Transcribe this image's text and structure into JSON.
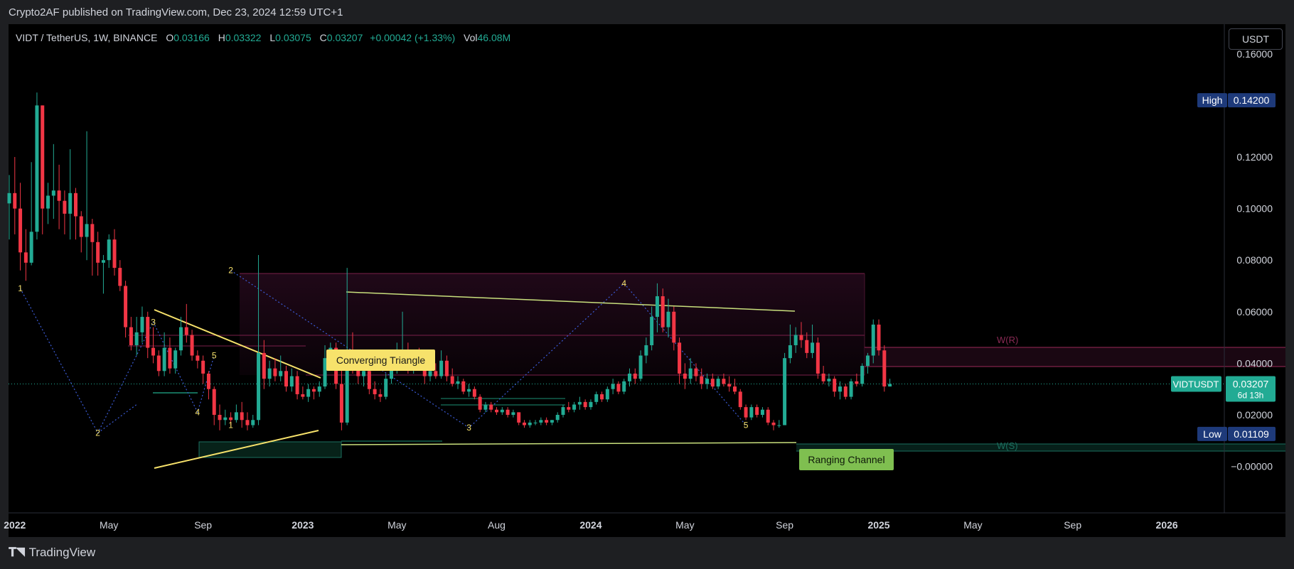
{
  "publisher_line": "Crypto2AF published on TradingView.com, Dec 23, 2024 12:59 UTC+1",
  "legend": {
    "symbol": "VIDT / TetherUS, 1W, BINANCE",
    "open_label": "O",
    "open": "0.03166",
    "high_label": "H",
    "high": "0.03322",
    "low_label": "L",
    "low": "0.03075",
    "close_label": "C",
    "close": "0.03207",
    "change": "+0.00042 (+1.33%)",
    "vol_label": "Vol",
    "vol": "46.08M"
  },
  "currency_button": "USDT",
  "brand": "TradingView",
  "colors": {
    "up": "#22ab94",
    "down": "#f23645",
    "accent_yellow": "#f7e26b",
    "background": "#000000"
  },
  "chart_data": {
    "type": "candlestick",
    "ylim": [
      -0.012,
      0.177
    ],
    "y_ticks": [
      {
        "value": 0.16,
        "label": "0.16000"
      },
      {
        "value": 0.12,
        "label": "0.12000"
      },
      {
        "value": 0.1,
        "label": "0.10000"
      },
      {
        "value": 0.08,
        "label": "0.08000"
      },
      {
        "value": 0.06,
        "label": "0.06000"
      },
      {
        "value": 0.04,
        "label": "0.04000"
      },
      {
        "value": 0.02,
        "label": "0.02000"
      },
      {
        "value": 0.0,
        "label": "−0.00000"
      }
    ],
    "x_ticks": [
      {
        "i": -16,
        "label": "Sep"
      },
      {
        "i": 1,
        "label": "2022",
        "bold": true
      },
      {
        "i": 18,
        "label": "May"
      },
      {
        "i": 35,
        "label": "Sep"
      },
      {
        "i": 53,
        "label": "2023",
        "bold": true
      },
      {
        "i": 70,
        "label": "May"
      },
      {
        "i": 88,
        "label": "Aug"
      },
      {
        "i": 105,
        "label": "2024",
        "bold": true
      },
      {
        "i": 122,
        "label": "May"
      },
      {
        "i": 140,
        "label": "Sep"
      },
      {
        "i": 157,
        "label": "2025",
        "bold": true
      },
      {
        "i": 174,
        "label": "May"
      },
      {
        "i": 192,
        "label": "Sep"
      },
      {
        "i": 209,
        "label": "2026",
        "bold": true
      }
    ],
    "price_markers": [
      {
        "label": "High",
        "value": "0.14200",
        "y": 0.142
      },
      {
        "label": "Low",
        "value": "0.01109",
        "y": 0.0126
      },
      {
        "label": "VIDTUSDT",
        "value": "0.03207",
        "sub": "6d 13h",
        "y": 0.032
      }
    ],
    "annotations": {
      "converging_triangle": "Converging Triangle",
      "ranging_channel": "Ranging Channel",
      "wr": "W(R)",
      "ws": "W(S)"
    },
    "wave_labels": [
      {
        "text": "1",
        "i": 2,
        "y": 0.069
      },
      {
        "text": "2",
        "i": 16,
        "y": 0.013
      },
      {
        "text": "3",
        "i": 26,
        "y": 0.056
      },
      {
        "text": "4",
        "i": 34,
        "y": 0.021
      },
      {
        "text": "5",
        "i": 37,
        "y": 0.043
      },
      {
        "text": "1",
        "i": 40,
        "y": 0.016
      },
      {
        "text": "2",
        "i": 40,
        "y": 0.076
      },
      {
        "text": "3",
        "i": 83,
        "y": 0.015
      },
      {
        "text": "4",
        "i": 111,
        "y": 0.071
      },
      {
        "text": "5",
        "i": 133,
        "y": 0.016
      }
    ],
    "ohlc": [
      [
        0.102,
        0.113,
        0.088,
        0.106
      ],
      [
        0.106,
        0.12,
        0.09,
        0.1
      ],
      [
        0.1,
        0.11,
        0.076,
        0.083
      ],
      [
        0.083,
        0.092,
        0.072,
        0.079
      ],
      [
        0.079,
        0.118,
        0.078,
        0.091
      ],
      [
        0.091,
        0.145,
        0.088,
        0.14
      ],
      [
        0.14,
        0.14,
        0.09,
        0.1
      ],
      [
        0.1,
        0.11,
        0.094,
        0.105
      ],
      [
        0.105,
        0.125,
        0.096,
        0.107
      ],
      [
        0.107,
        0.117,
        0.092,
        0.103
      ],
      [
        0.103,
        0.107,
        0.09,
        0.098
      ],
      [
        0.098,
        0.123,
        0.088,
        0.106
      ],
      [
        0.106,
        0.108,
        0.088,
        0.097
      ],
      [
        0.097,
        0.099,
        0.083,
        0.089
      ],
      [
        0.089,
        0.13,
        0.08,
        0.094
      ],
      [
        0.094,
        0.096,
        0.074,
        0.087
      ],
      [
        0.087,
        0.091,
        0.074,
        0.079
      ],
      [
        0.079,
        0.082,
        0.067,
        0.08
      ],
      [
        0.08,
        0.09,
        0.077,
        0.088
      ],
      [
        0.088,
        0.092,
        0.074,
        0.077
      ],
      [
        0.077,
        0.08,
        0.068,
        0.07
      ],
      [
        0.07,
        0.072,
        0.05,
        0.054
      ],
      [
        0.054,
        0.058,
        0.045,
        0.047
      ],
      [
        0.047,
        0.058,
        0.043,
        0.052
      ],
      [
        0.052,
        0.062,
        0.048,
        0.058
      ],
      [
        0.058,
        0.06,
        0.042,
        0.046
      ],
      [
        0.046,
        0.054,
        0.04,
        0.043
      ],
      [
        0.043,
        0.045,
        0.035,
        0.037
      ],
      [
        0.037,
        0.052,
        0.035,
        0.046
      ],
      [
        0.046,
        0.05,
        0.036,
        0.038
      ],
      [
        0.038,
        0.046,
        0.036,
        0.045
      ],
      [
        0.045,
        0.058,
        0.043,
        0.054
      ],
      [
        0.054,
        0.063,
        0.048,
        0.051
      ],
      [
        0.051,
        0.053,
        0.041,
        0.043
      ],
      [
        0.043,
        0.045,
        0.038,
        0.041
      ],
      [
        0.041,
        0.043,
        0.032,
        0.036
      ],
      [
        0.036,
        0.037,
        0.026,
        0.03
      ],
      [
        0.03,
        0.031,
        0.016,
        0.02
      ],
      [
        0.02,
        0.024,
        0.014,
        0.018
      ],
      [
        0.018,
        0.022,
        0.016,
        0.019
      ],
      [
        0.019,
        0.021,
        0.016,
        0.018
      ],
      [
        0.018,
        0.024,
        0.017,
        0.021
      ],
      [
        0.021,
        0.025,
        0.015,
        0.018
      ],
      [
        0.018,
        0.021,
        0.014,
        0.016
      ],
      [
        0.016,
        0.02,
        0.015,
        0.018
      ],
      [
        0.018,
        0.082,
        0.016,
        0.044
      ],
      [
        0.044,
        0.049,
        0.03,
        0.034
      ],
      [
        0.034,
        0.041,
        0.031,
        0.038
      ],
      [
        0.038,
        0.042,
        0.033,
        0.035
      ],
      [
        0.035,
        0.043,
        0.033,
        0.037
      ],
      [
        0.037,
        0.039,
        0.029,
        0.031
      ],
      [
        0.031,
        0.038,
        0.029,
        0.035
      ],
      [
        0.035,
        0.037,
        0.026,
        0.028
      ],
      [
        0.028,
        0.031,
        0.026,
        0.027
      ],
      [
        0.027,
        0.032,
        0.025,
        0.03
      ],
      [
        0.03,
        0.031,
        0.026,
        0.029
      ],
      [
        0.029,
        0.033,
        0.027,
        0.031
      ],
      [
        0.031,
        0.047,
        0.03,
        0.042
      ],
      [
        0.042,
        0.048,
        0.038,
        0.046
      ],
      [
        0.046,
        0.048,
        0.03,
        0.032
      ],
      [
        0.032,
        0.042,
        0.014,
        0.017
      ],
      [
        0.017,
        0.077,
        0.016,
        0.044
      ],
      [
        0.044,
        0.052,
        0.036,
        0.038
      ],
      [
        0.038,
        0.042,
        0.032,
        0.035
      ],
      [
        0.035,
        0.04,
        0.031,
        0.037
      ],
      [
        0.037,
        0.04,
        0.028,
        0.03
      ],
      [
        0.03,
        0.033,
        0.026,
        0.028
      ],
      [
        0.028,
        0.03,
        0.025,
        0.027
      ],
      [
        0.027,
        0.036,
        0.026,
        0.034
      ],
      [
        0.034,
        0.04,
        0.032,
        0.038
      ],
      [
        0.038,
        0.048,
        0.036,
        0.044
      ],
      [
        0.044,
        0.06,
        0.04,
        0.045
      ],
      [
        0.045,
        0.048,
        0.036,
        0.039
      ],
      [
        0.039,
        0.045,
        0.036,
        0.043
      ],
      [
        0.043,
        0.046,
        0.038,
        0.04
      ],
      [
        0.04,
        0.042,
        0.032,
        0.035
      ],
      [
        0.035,
        0.039,
        0.033,
        0.037
      ],
      [
        0.037,
        0.04,
        0.034,
        0.035
      ],
      [
        0.035,
        0.045,
        0.034,
        0.041
      ],
      [
        0.041,
        0.043,
        0.033,
        0.035
      ],
      [
        0.035,
        0.038,
        0.031,
        0.032
      ],
      [
        0.032,
        0.035,
        0.03,
        0.033
      ],
      [
        0.033,
        0.034,
        0.028,
        0.029
      ],
      [
        0.029,
        0.032,
        0.027,
        0.03
      ],
      [
        0.03,
        0.031,
        0.026,
        0.027
      ],
      [
        0.027,
        0.028,
        0.021,
        0.022
      ],
      [
        0.022,
        0.025,
        0.021,
        0.024
      ],
      [
        0.024,
        0.025,
        0.021,
        0.022
      ],
      [
        0.022,
        0.023,
        0.02,
        0.021
      ],
      [
        0.021,
        0.023,
        0.02,
        0.022
      ],
      [
        0.022,
        0.023,
        0.019,
        0.02
      ],
      [
        0.02,
        0.022,
        0.019,
        0.021
      ],
      [
        0.021,
        0.021,
        0.016,
        0.017
      ],
      [
        0.017,
        0.018,
        0.015,
        0.016
      ],
      [
        0.016,
        0.018,
        0.015,
        0.017
      ],
      [
        0.017,
        0.018,
        0.016,
        0.017
      ],
      [
        0.017,
        0.019,
        0.016,
        0.018
      ],
      [
        0.018,
        0.019,
        0.016,
        0.017
      ],
      [
        0.017,
        0.018,
        0.016,
        0.018
      ],
      [
        0.018,
        0.021,
        0.017,
        0.02
      ],
      [
        0.02,
        0.024,
        0.019,
        0.023
      ],
      [
        0.023,
        0.025,
        0.021,
        0.022
      ],
      [
        0.022,
        0.025,
        0.021,
        0.024
      ],
      [
        0.024,
        0.027,
        0.022,
        0.025
      ],
      [
        0.025,
        0.026,
        0.022,
        0.023
      ],
      [
        0.023,
        0.026,
        0.022,
        0.025
      ],
      [
        0.025,
        0.029,
        0.024,
        0.028
      ],
      [
        0.028,
        0.029,
        0.025,
        0.026
      ],
      [
        0.026,
        0.031,
        0.025,
        0.03
      ],
      [
        0.03,
        0.034,
        0.028,
        0.032
      ],
      [
        0.032,
        0.033,
        0.028,
        0.029
      ],
      [
        0.029,
        0.034,
        0.028,
        0.033
      ],
      [
        0.033,
        0.038,
        0.031,
        0.036
      ],
      [
        0.036,
        0.038,
        0.032,
        0.034
      ],
      [
        0.034,
        0.045,
        0.033,
        0.043
      ],
      [
        0.043,
        0.05,
        0.04,
        0.047
      ],
      [
        0.047,
        0.062,
        0.045,
        0.058
      ],
      [
        0.058,
        0.071,
        0.052,
        0.066
      ],
      [
        0.066,
        0.069,
        0.052,
        0.054
      ],
      [
        0.054,
        0.065,
        0.05,
        0.06
      ],
      [
        0.06,
        0.062,
        0.045,
        0.048
      ],
      [
        0.048,
        0.05,
        0.032,
        0.036
      ],
      [
        0.036,
        0.04,
        0.03,
        0.034
      ],
      [
        0.034,
        0.042,
        0.032,
        0.038
      ],
      [
        0.038,
        0.04,
        0.033,
        0.035
      ],
      [
        0.035,
        0.038,
        0.03,
        0.032
      ],
      [
        0.032,
        0.036,
        0.03,
        0.034
      ],
      [
        0.034,
        0.036,
        0.03,
        0.031
      ],
      [
        0.031,
        0.035,
        0.03,
        0.034
      ],
      [
        0.034,
        0.036,
        0.031,
        0.032
      ],
      [
        0.032,
        0.035,
        0.029,
        0.031
      ],
      [
        0.031,
        0.034,
        0.028,
        0.029
      ],
      [
        0.029,
        0.03,
        0.022,
        0.023
      ],
      [
        0.023,
        0.024,
        0.018,
        0.019
      ],
      [
        0.019,
        0.024,
        0.018,
        0.023
      ],
      [
        0.023,
        0.024,
        0.019,
        0.02
      ],
      [
        0.02,
        0.023,
        0.019,
        0.022
      ],
      [
        0.022,
        0.023,
        0.016,
        0.017
      ],
      [
        0.017,
        0.018,
        0.014,
        0.016
      ],
      [
        0.016,
        0.018,
        0.015,
        0.016
      ],
      [
        0.016,
        0.044,
        0.016,
        0.042
      ],
      [
        0.042,
        0.055,
        0.04,
        0.047
      ],
      [
        0.047,
        0.054,
        0.044,
        0.051
      ],
      [
        0.051,
        0.056,
        0.046,
        0.049
      ],
      [
        0.049,
        0.052,
        0.042,
        0.044
      ],
      [
        0.044,
        0.055,
        0.042,
        0.048
      ],
      [
        0.048,
        0.05,
        0.034,
        0.036
      ],
      [
        0.036,
        0.039,
        0.032,
        0.033
      ],
      [
        0.033,
        0.036,
        0.031,
        0.034
      ],
      [
        0.034,
        0.035,
        0.027,
        0.029
      ],
      [
        0.029,
        0.033,
        0.026,
        0.031
      ],
      [
        0.031,
        0.032,
        0.026,
        0.027
      ],
      [
        0.027,
        0.034,
        0.026,
        0.033
      ],
      [
        0.033,
        0.036,
        0.031,
        0.032
      ],
      [
        0.032,
        0.04,
        0.031,
        0.039
      ],
      [
        0.039,
        0.044,
        0.036,
        0.043
      ],
      [
        0.043,
        0.057,
        0.04,
        0.055
      ],
      [
        0.055,
        0.057,
        0.043,
        0.045
      ],
      [
        0.045,
        0.047,
        0.029,
        0.031
      ],
      [
        0.031,
        0.034,
        0.031,
        0.032
      ]
    ]
  }
}
